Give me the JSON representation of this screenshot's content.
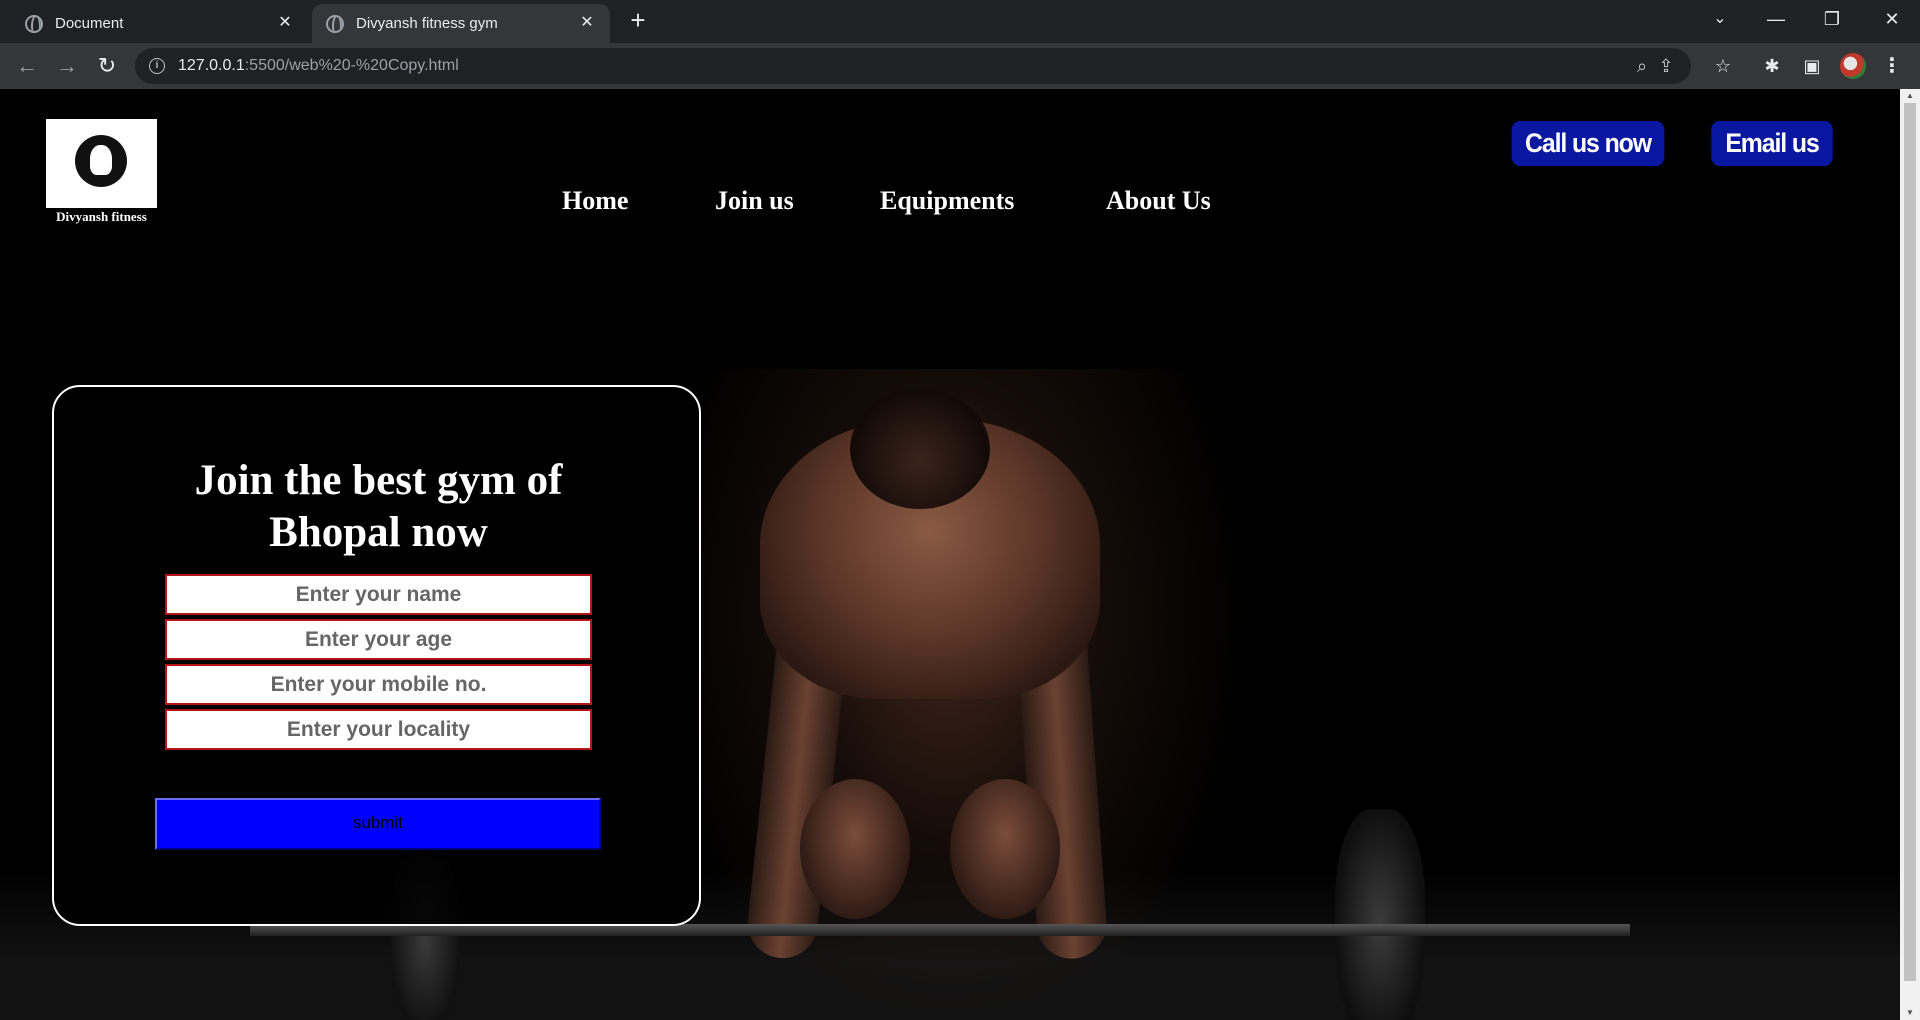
{
  "browser": {
    "tabs": [
      {
        "title": "Document",
        "active": false
      },
      {
        "title": "Divyansh fitness gym",
        "active": true
      }
    ],
    "url_host": "127.0.0.1",
    "url_rest": ":5500/web%20-%20Copy.html"
  },
  "page": {
    "logo_text": "Divyansh fitness",
    "nav": [
      "Home",
      "Join us",
      "Equipments",
      "About Us"
    ],
    "cta": {
      "call": "Call us now",
      "email": "Email us"
    },
    "form": {
      "heading_line1": "Join the best gym of",
      "heading_line2": "Bhopal now",
      "fields": [
        "Enter your name",
        "Enter your age",
        "Enter your mobile no.",
        "Enter your locality"
      ],
      "submit": "submit"
    }
  },
  "colors": {
    "cta_bg": "#0a17a1",
    "submit_bg": "#0000ff",
    "field_border": "#b3151b"
  }
}
